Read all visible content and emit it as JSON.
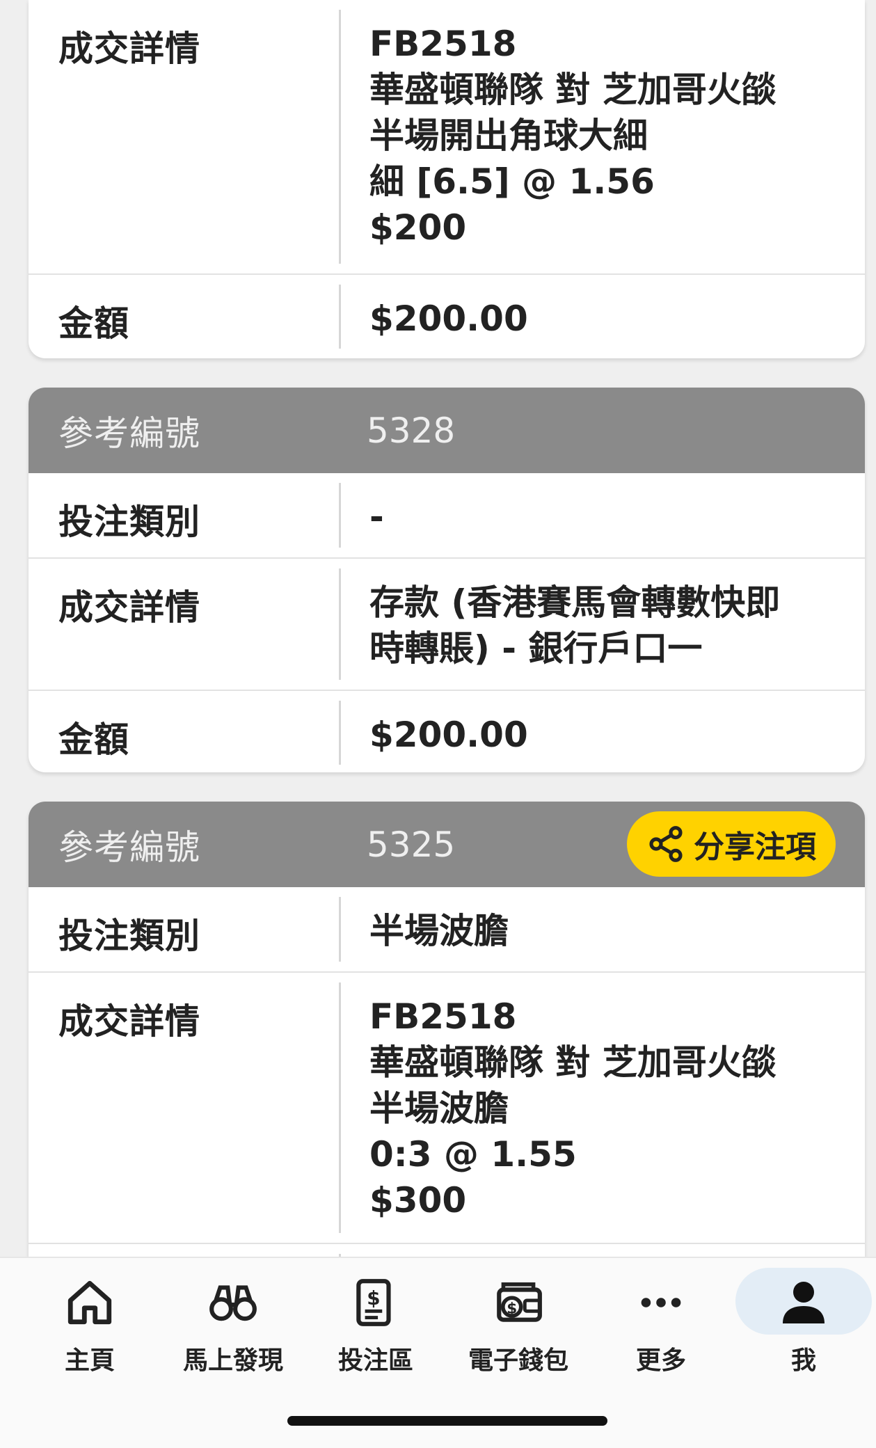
{
  "card1": {
    "detail_label": "成交詳情",
    "detail_lines": [
      "FB2518",
      "華盛頓聯隊 對 芝加哥火燄",
      "半場開出角球大細",
      "細 [6.5] @ 1.56",
      "$200"
    ],
    "amount_label": "金額",
    "amount_value": "$200.00"
  },
  "card2": {
    "ref_label": "參考編號",
    "ref_value": "5328",
    "type_label": "投注類別",
    "type_value": "-",
    "detail_label": "成交詳情",
    "detail_lines": [
      "存款 (香港賽馬會轉數快即",
      "時轉賬) - 銀行戶口一"
    ],
    "amount_label": "金額",
    "amount_value": "$200.00"
  },
  "card3": {
    "ref_label": "參考編號",
    "ref_value": "5325",
    "share_label": "分享注項",
    "type_label": "投注類別",
    "type_value": "半場波膽",
    "detail_label": "成交詳情",
    "detail_lines": [
      "FB2518",
      "華盛頓聯隊 對 芝加哥火燄",
      "半場波膽",
      "0:3 @ 1.55",
      "$300"
    ]
  },
  "nav": {
    "items": [
      {
        "label": "主頁",
        "icon": "home-icon"
      },
      {
        "label": "馬上發現",
        "icon": "binoculars-icon"
      },
      {
        "label": "投注區",
        "icon": "betting-slip-icon"
      },
      {
        "label": "電子錢包",
        "icon": "wallet-icon"
      },
      {
        "label": "更多",
        "icon": "more-icon"
      },
      {
        "label": "我",
        "icon": "user-icon"
      }
    ],
    "active": "我"
  },
  "colors": {
    "header_grey": "#8a8a8a",
    "accent_yellow": "#ffd200",
    "active_nav_bg": "#e3edf6"
  }
}
